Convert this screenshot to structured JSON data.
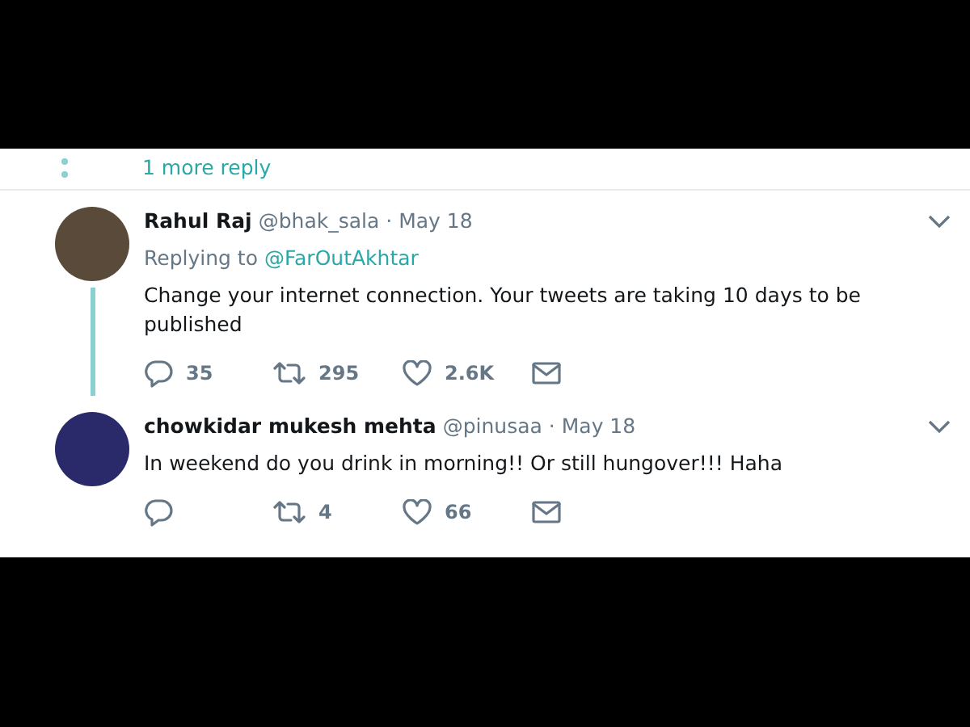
{
  "more_replies": {
    "label": "1 more reply"
  },
  "tweets": [
    {
      "name": "Rahul Raj",
      "handle": "@bhak_sala",
      "date": "· May 18",
      "replying_to": {
        "label": "Replying to",
        "handle": "@FarOutAkhtar"
      },
      "text": "Change your internet connection. Your tweets are taking 10 days to be published",
      "replies": "35",
      "retweets": "295",
      "likes": "2.6K",
      "thread_line": true
    },
    {
      "name": "chowkidar mukesh mehta",
      "handle": "@pinusaa",
      "date": "· May 18",
      "text": "In weekend do you drink in morning!! Or still hungover!!! Haha",
      "retweets": "4",
      "likes": "66",
      "thread_line": false
    }
  ]
}
